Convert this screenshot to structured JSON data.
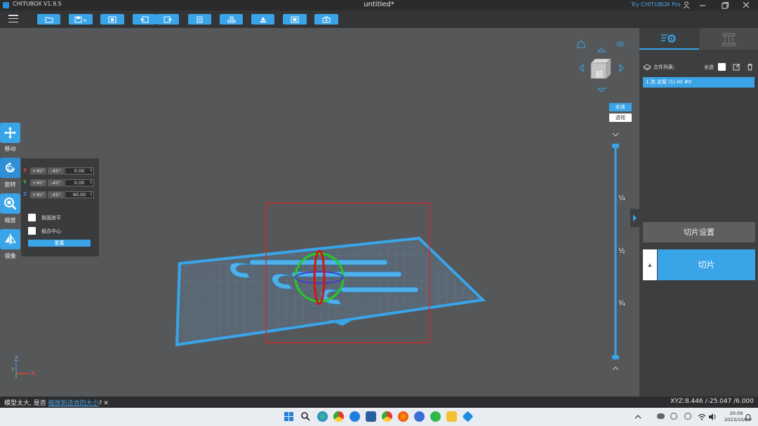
{
  "titlebar": {
    "app_name": "CHITUBOX V1.9.5",
    "document_title": "untitled*",
    "promo_link": "Try CHITUBOX Pro"
  },
  "toolbar": {
    "icons": [
      "open-file-icon",
      "save-dropdown-icon",
      "screenshot-icon",
      "undo-icon",
      "redo-icon",
      "copy-icon",
      "layout-icon",
      "support-icon",
      "hollow-icon",
      "drill-icon"
    ]
  },
  "left_tools": {
    "move_label": "移动",
    "rotate_label": "旋转",
    "scale_label": "缩放",
    "mirror_label": "镜像"
  },
  "rotate_panel": {
    "rows": [
      {
        "axis": "X",
        "axis_color": "#e04040",
        "plus": "+45°",
        "minus": "-45°",
        "value": "0.00"
      },
      {
        "axis": "Y",
        "axis_color": "#40c040",
        "plus": "+45°",
        "minus": "-45°",
        "value": "0.00"
      },
      {
        "axis": "Z",
        "axis_color": "#4f7fe0",
        "plus": "+45°",
        "minus": "-45°",
        "value": "90.00"
      }
    ],
    "lay_flat_label": "按面放平",
    "group_center_label": "组合中心",
    "reset_label": "重置"
  },
  "view_cube": {
    "face_label": "前",
    "solid_label": "实体",
    "transparent_label": "透视"
  },
  "layer_slider": {
    "quarter": "¼",
    "half": "½",
    "three_quarter": "¾"
  },
  "axis_indicator": {
    "z": "Z",
    "y": "Y",
    "x": "X"
  },
  "right_panel": {
    "file_list_label": "文件列表:",
    "select_all_label": "全选",
    "files": [
      "1.流 支架 (1).stl #0"
    ],
    "slice_settings_label": "切片设置",
    "slice_side_label": "▲",
    "slice_label": "切片"
  },
  "status": {
    "message_prefix": "模型太大, 是否 ",
    "message_link": "缩放到适合的大小",
    "message_suffix": "?",
    "close_glyph": "✕",
    "coordinates": "XYZ:8.446 /-25.047 /6.000"
  },
  "taskbar": {
    "time": "20:09",
    "date": "2023/10/22"
  },
  "colors": {
    "accent": "#3aa4e8",
    "model": "#4fb1ea",
    "selection": "#e32222",
    "gizmo_green": "#22cc22",
    "gizmo_red": "#dd1111",
    "gizmo_blue": "#4040cc"
  }
}
